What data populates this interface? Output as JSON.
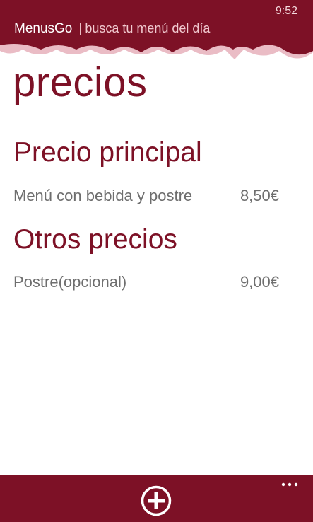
{
  "status_bar": {
    "time": "9:52"
  },
  "header": {
    "app_name": "MenusGo",
    "separator": "|",
    "tagline": "busca tu menú del día"
  },
  "page": {
    "title": "precios"
  },
  "sections": [
    {
      "heading": "Precio principal",
      "items": [
        {
          "name": "Menú con bebida y postre",
          "price": "8,50€"
        }
      ]
    },
    {
      "heading": "Otros precios",
      "items": [
        {
          "name": "Postre(opcional)",
          "price": "9,00€"
        }
      ]
    }
  ],
  "app_bar": {
    "add_icon": "plus-circle-icon",
    "more_icon": "ellipsis-icon"
  },
  "colors": {
    "brand": "#7d1126",
    "background": "#ffffff",
    "text_secondary": "#6e6e6e"
  }
}
